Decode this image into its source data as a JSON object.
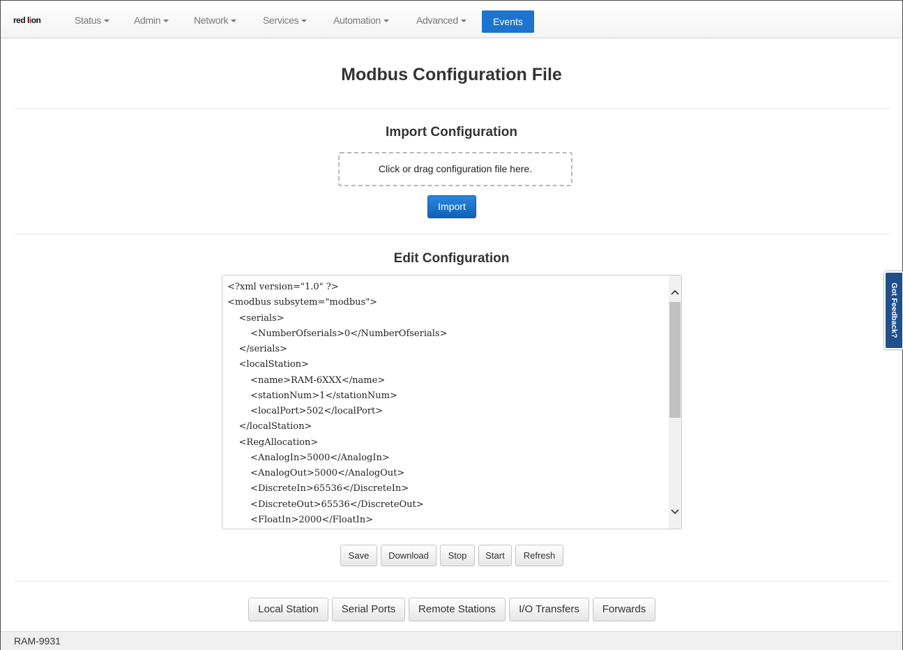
{
  "navbar": {
    "logo": {
      "part1": "red l",
      "part2": "i",
      "part3": "on"
    },
    "items": [
      {
        "label": "Status",
        "dropdown": true
      },
      {
        "label": "Admin",
        "dropdown": true
      },
      {
        "label": "Network",
        "dropdown": true
      },
      {
        "label": "Services",
        "dropdown": true
      },
      {
        "label": "Automation",
        "dropdown": true
      },
      {
        "label": "Advanced",
        "dropdown": true
      }
    ],
    "active": {
      "label": "Events"
    }
  },
  "page": {
    "title": "Modbus Configuration File"
  },
  "import": {
    "title": "Import Configuration",
    "dropzone_text": "Click or drag configuration file here.",
    "button": "Import"
  },
  "edit": {
    "title": "Edit Configuration",
    "code_lines": [
      "<?xml version=\"1.0\" ?>",
      "<modbus subsytem=\"modbus\">",
      "    <serials>",
      "        <NumberOfserials>0</NumberOfserials>",
      "    </serials>",
      "    <localStation>",
      "        <name>RAM-6XXX</name>",
      "        <stationNum>1</stationNum>",
      "        <localPort>502</localPort>",
      "    </localStation>",
      "    <RegAllocation>",
      "        <AnalogIn>5000</AnalogIn>",
      "        <AnalogOut>5000</AnalogOut>",
      "        <DiscreteIn>65536</DiscreteIn>",
      "        <DiscreteOut>65536</DiscreteOut>",
      "        <FloatIn>2000</FloatIn>"
    ],
    "buttons": {
      "save": "Save",
      "download": "Download",
      "stop": "Stop",
      "start": "Start",
      "refresh": "Refresh"
    }
  },
  "subnav": {
    "local_station": "Local Station",
    "serial_ports": "Serial Ports",
    "remote_stations": "Remote Stations",
    "io_transfers": "I/O Transfers",
    "forwards": "Forwards"
  },
  "feedback": {
    "label": "Got Feedback?"
  },
  "footer": {
    "device": "RAM-9931"
  },
  "icons": {
    "scroll_up": "chevron-up-icon",
    "scroll_down": "chevron-down-icon",
    "caret": "caret-down-icon"
  },
  "colors": {
    "accent": "#1a74d0",
    "feedback": "#1f4f8c",
    "logo_red": "#c8102e"
  }
}
